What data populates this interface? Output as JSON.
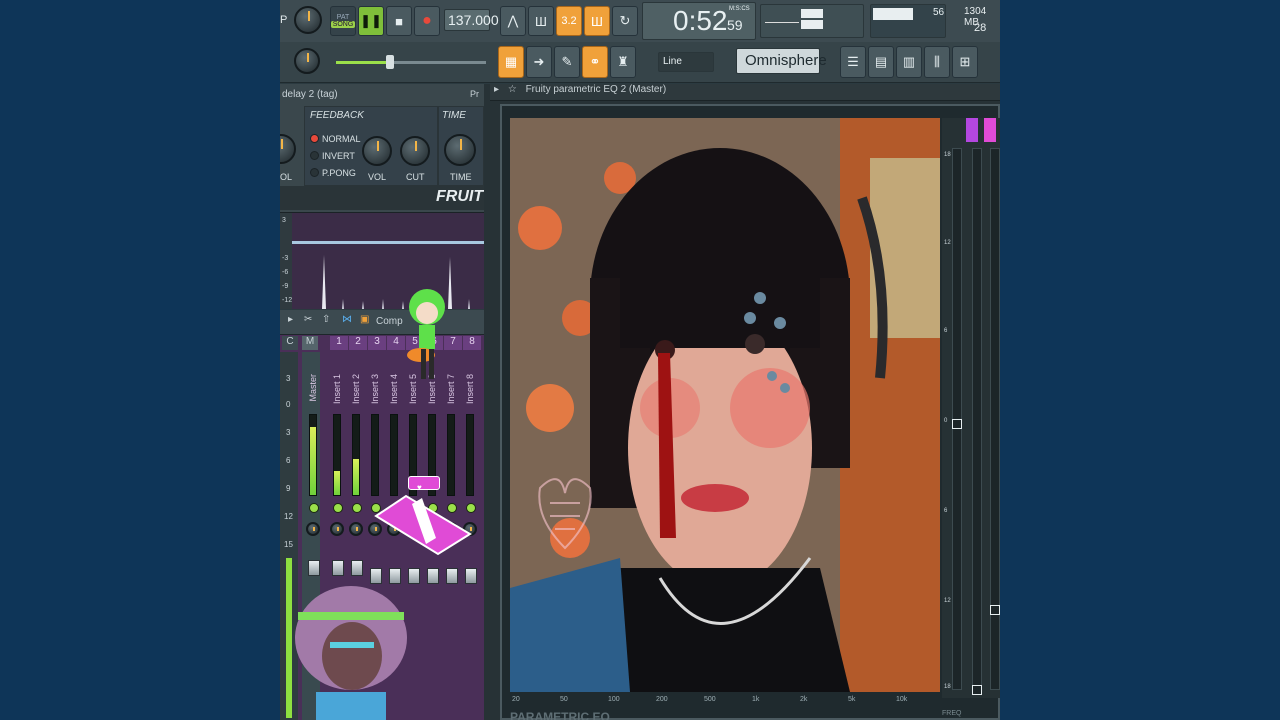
{
  "toolbar": {
    "pat_label": "PAT",
    "song_label": "SONG",
    "tempo": "137.000",
    "time": "0:52",
    "time_small": "59",
    "time_unit": "M:S:CS",
    "memory": "1304 MB",
    "cpu": "56",
    "voices": "28",
    "snap": "Line",
    "plugin_name": "Omnisphere",
    "hint_letter": "P",
    "pitch_btn": "3.2",
    "icons": [
      "tick-icon",
      "typing-keyboard-icon",
      "countdown-icon",
      "step-record-icon",
      "loop-record-icon",
      "piano-icon",
      "arrow-icon",
      "draw-icon",
      "link-icon",
      "stamp-icon",
      "playlist-icon",
      "piano-roll-icon",
      "channel-rack-icon",
      "mixer-icon",
      "browser-icon"
    ]
  },
  "delay": {
    "title": "delay 2 (tag)",
    "pr_label": "Pr",
    "feedback_header": "FEEDBACK",
    "time_header": "TIME",
    "modes": [
      "NORMAL",
      "INVERT",
      "P.PONG"
    ],
    "vol_label": "VOL",
    "vol_left_label": "OL",
    "cut_label": "CUT",
    "time_label": "TIME",
    "brand": "FRUIT"
  },
  "wave": {
    "scale": [
      "3",
      "-3",
      "-6",
      "-9",
      "-12"
    ]
  },
  "mixer": {
    "toolbar_label": "Comp",
    "cm": [
      "C",
      "M"
    ],
    "numbers": [
      "1",
      "2",
      "3",
      "4",
      "5",
      "6",
      "7",
      "8"
    ],
    "channels": [
      "Master",
      "Insert 1",
      "Insert 2",
      "Insert 3",
      "Insert 4",
      "Insert 5",
      "Insert 6",
      "Insert 7",
      "Insert 8"
    ],
    "db_scale": [
      "3",
      "0",
      "3",
      "6",
      "9",
      "12",
      "15"
    ],
    "levels": [
      0.85,
      0.3,
      0.45,
      0,
      0,
      0,
      0,
      0,
      0
    ]
  },
  "eq": {
    "title": "Fruity parametric EQ 2 (Master)",
    "footer": "PARAMETRIC EQ",
    "freq_label": "FREQ",
    "db_scale": [
      "18",
      "12",
      "6",
      "0",
      "6",
      "12",
      "18"
    ],
    "freqs": [
      "20",
      "50",
      "100",
      "200",
      "500",
      "1k",
      "2k",
      "5k",
      "10k"
    ]
  },
  "colors": {
    "accent": "#f0a13a",
    "background": "#0e3558",
    "mixer": "#4a2f58",
    "meter": "#8fe040",
    "pink": "#e04bd6"
  }
}
